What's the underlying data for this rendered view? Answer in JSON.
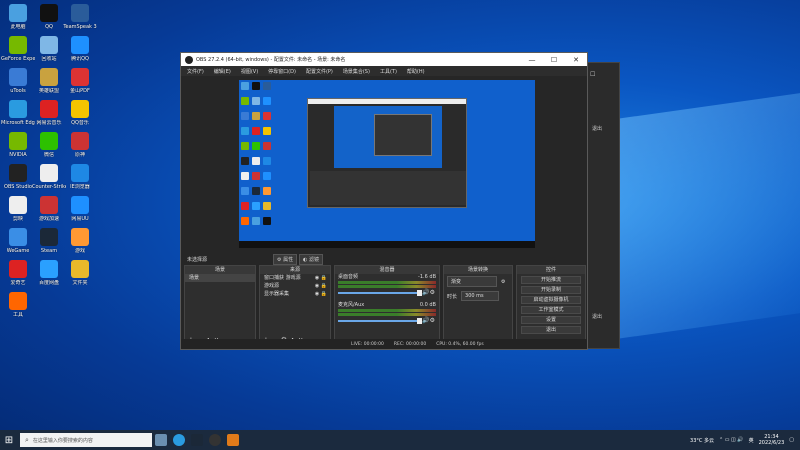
{
  "desktop_icons": [
    {
      "label": "此电脑",
      "color": "#4aa0e0"
    },
    {
      "label": "QQ",
      "color": "#111"
    },
    {
      "label": "TeamSpeak 3",
      "color": "#2a5c9a"
    },
    {
      "label": "GeForce Experience",
      "color": "#76b900"
    },
    {
      "label": "回收站",
      "color": "#7fb7e6"
    },
    {
      "label": "腾讯QQ",
      "color": "#1e90ff"
    },
    {
      "label": "uTools",
      "color": "#3a7bd5"
    },
    {
      "label": "英雄联盟",
      "color": "#c9a23f"
    },
    {
      "label": "金山PDF",
      "color": "#d33"
    },
    {
      "label": "Microsoft Edge",
      "color": "#2a9be0"
    },
    {
      "label": "网易云音乐",
      "color": "#d22"
    },
    {
      "label": "QQ音乐",
      "color": "#f4c400"
    },
    {
      "label": "NVIDIA",
      "color": "#76b900"
    },
    {
      "label": "微信",
      "color": "#2dc100"
    },
    {
      "label": "原神",
      "color": "#c33"
    },
    {
      "label": "OBS Studio",
      "color": "#222"
    },
    {
      "label": "Counter-Strike",
      "color": "#eee"
    },
    {
      "label": "IE浏览器",
      "color": "#1e88e5"
    },
    {
      "label": "剪映",
      "color": "#eee"
    },
    {
      "label": "游戏加速",
      "color": "#c33"
    },
    {
      "label": "网易UU",
      "color": "#1e90ff"
    },
    {
      "label": "WeGame",
      "color": "#3a8ee6"
    },
    {
      "label": "Steam",
      "color": "#1b2838"
    },
    {
      "label": "游戏",
      "color": "#f93"
    },
    {
      "label": "爱奇艺",
      "color": "#d22"
    },
    {
      "label": "百度网盘",
      "color": "#2aa0ff"
    },
    {
      "label": "文件夹",
      "color": "#e8b92a"
    },
    {
      "label": "工具",
      "color": "#f60"
    }
  ],
  "obs": {
    "title": "OBS 27.2.4 (64-bit, windows) - 配置文件: 未命名 - 场景: 未命名",
    "window_controls": [
      "—",
      "☐",
      "✕"
    ],
    "menu": [
      "文件(F)",
      "编辑(E)",
      "视图(V)",
      "停靠窗口(D)",
      "配置文件(P)",
      "场景集合(S)",
      "工具(T)",
      "帮助(H)"
    ],
    "current_scene": "未选择源",
    "toolbar_buttons": [
      "属性",
      "滤镜"
    ],
    "docks": {
      "scenes": {
        "title": "场景",
        "items": [
          "场景"
        ]
      },
      "sources": {
        "title": "来源",
        "items": [
          "窗口捕获 游戏源",
          "游戏源",
          "显示器采集"
        ]
      },
      "mixer": {
        "title": "混音器",
        "channels": [
          {
            "name": "桌面音频",
            "db": "-1.6 dB"
          },
          {
            "name": "麦克风/Aux",
            "db": "0.0 dB"
          }
        ]
      },
      "transitions": {
        "title": "场景转换",
        "selected": "渐变",
        "duration_label": "时长",
        "duration": "300 ms"
      },
      "controls": {
        "title": "控件",
        "buttons": [
          "开始推流",
          "开始录制",
          "启动虚拟摄像机",
          "工作室模式",
          "设置",
          "退出"
        ]
      }
    },
    "status": {
      "live": "LIVE: 00:00:00",
      "rec": "REC: 00:00:00",
      "cpu": "CPU: 0.4%, 60.00 fps"
    }
  },
  "bg_window": {
    "labels": [
      "退出",
      "退出"
    ]
  },
  "taskbar": {
    "search_placeholder": "在这里输入你要搜索的内容",
    "weather": "33°C 多云",
    "time": "21:34",
    "date": "2022/6/23",
    "ime": "英"
  }
}
